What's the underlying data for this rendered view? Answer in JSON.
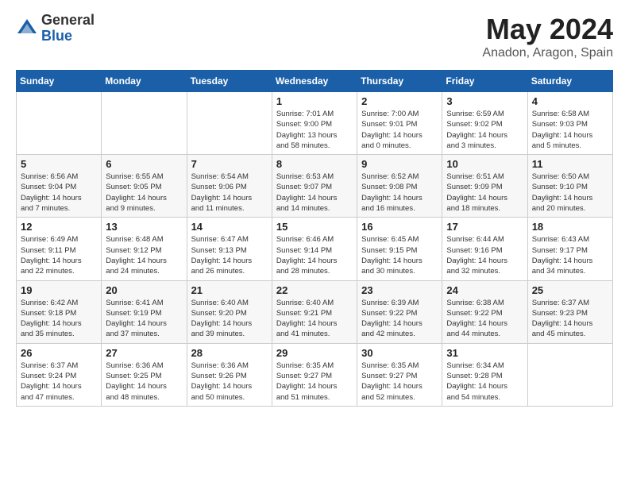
{
  "header": {
    "logo_general": "General",
    "logo_blue": "Blue",
    "month": "May 2024",
    "location": "Anadon, Aragon, Spain"
  },
  "weekdays": [
    "Sunday",
    "Monday",
    "Tuesday",
    "Wednesday",
    "Thursday",
    "Friday",
    "Saturday"
  ],
  "weeks": [
    [
      {
        "day": "",
        "info": ""
      },
      {
        "day": "",
        "info": ""
      },
      {
        "day": "",
        "info": ""
      },
      {
        "day": "1",
        "info": "Sunrise: 7:01 AM\nSunset: 9:00 PM\nDaylight: 13 hours\nand 58 minutes."
      },
      {
        "day": "2",
        "info": "Sunrise: 7:00 AM\nSunset: 9:01 PM\nDaylight: 14 hours\nand 0 minutes."
      },
      {
        "day": "3",
        "info": "Sunrise: 6:59 AM\nSunset: 9:02 PM\nDaylight: 14 hours\nand 3 minutes."
      },
      {
        "day": "4",
        "info": "Sunrise: 6:58 AM\nSunset: 9:03 PM\nDaylight: 14 hours\nand 5 minutes."
      }
    ],
    [
      {
        "day": "5",
        "info": "Sunrise: 6:56 AM\nSunset: 9:04 PM\nDaylight: 14 hours\nand 7 minutes."
      },
      {
        "day": "6",
        "info": "Sunrise: 6:55 AM\nSunset: 9:05 PM\nDaylight: 14 hours\nand 9 minutes."
      },
      {
        "day": "7",
        "info": "Sunrise: 6:54 AM\nSunset: 9:06 PM\nDaylight: 14 hours\nand 11 minutes."
      },
      {
        "day": "8",
        "info": "Sunrise: 6:53 AM\nSunset: 9:07 PM\nDaylight: 14 hours\nand 14 minutes."
      },
      {
        "day": "9",
        "info": "Sunrise: 6:52 AM\nSunset: 9:08 PM\nDaylight: 14 hours\nand 16 minutes."
      },
      {
        "day": "10",
        "info": "Sunrise: 6:51 AM\nSunset: 9:09 PM\nDaylight: 14 hours\nand 18 minutes."
      },
      {
        "day": "11",
        "info": "Sunrise: 6:50 AM\nSunset: 9:10 PM\nDaylight: 14 hours\nand 20 minutes."
      }
    ],
    [
      {
        "day": "12",
        "info": "Sunrise: 6:49 AM\nSunset: 9:11 PM\nDaylight: 14 hours\nand 22 minutes."
      },
      {
        "day": "13",
        "info": "Sunrise: 6:48 AM\nSunset: 9:12 PM\nDaylight: 14 hours\nand 24 minutes."
      },
      {
        "day": "14",
        "info": "Sunrise: 6:47 AM\nSunset: 9:13 PM\nDaylight: 14 hours\nand 26 minutes."
      },
      {
        "day": "15",
        "info": "Sunrise: 6:46 AM\nSunset: 9:14 PM\nDaylight: 14 hours\nand 28 minutes."
      },
      {
        "day": "16",
        "info": "Sunrise: 6:45 AM\nSunset: 9:15 PM\nDaylight: 14 hours\nand 30 minutes."
      },
      {
        "day": "17",
        "info": "Sunrise: 6:44 AM\nSunset: 9:16 PM\nDaylight: 14 hours\nand 32 minutes."
      },
      {
        "day": "18",
        "info": "Sunrise: 6:43 AM\nSunset: 9:17 PM\nDaylight: 14 hours\nand 34 minutes."
      }
    ],
    [
      {
        "day": "19",
        "info": "Sunrise: 6:42 AM\nSunset: 9:18 PM\nDaylight: 14 hours\nand 35 minutes."
      },
      {
        "day": "20",
        "info": "Sunrise: 6:41 AM\nSunset: 9:19 PM\nDaylight: 14 hours\nand 37 minutes."
      },
      {
        "day": "21",
        "info": "Sunrise: 6:40 AM\nSunset: 9:20 PM\nDaylight: 14 hours\nand 39 minutes."
      },
      {
        "day": "22",
        "info": "Sunrise: 6:40 AM\nSunset: 9:21 PM\nDaylight: 14 hours\nand 41 minutes."
      },
      {
        "day": "23",
        "info": "Sunrise: 6:39 AM\nSunset: 9:22 PM\nDaylight: 14 hours\nand 42 minutes."
      },
      {
        "day": "24",
        "info": "Sunrise: 6:38 AM\nSunset: 9:22 PM\nDaylight: 14 hours\nand 44 minutes."
      },
      {
        "day": "25",
        "info": "Sunrise: 6:37 AM\nSunset: 9:23 PM\nDaylight: 14 hours\nand 45 minutes."
      }
    ],
    [
      {
        "day": "26",
        "info": "Sunrise: 6:37 AM\nSunset: 9:24 PM\nDaylight: 14 hours\nand 47 minutes."
      },
      {
        "day": "27",
        "info": "Sunrise: 6:36 AM\nSunset: 9:25 PM\nDaylight: 14 hours\nand 48 minutes."
      },
      {
        "day": "28",
        "info": "Sunrise: 6:36 AM\nSunset: 9:26 PM\nDaylight: 14 hours\nand 50 minutes."
      },
      {
        "day": "29",
        "info": "Sunrise: 6:35 AM\nSunset: 9:27 PM\nDaylight: 14 hours\nand 51 minutes."
      },
      {
        "day": "30",
        "info": "Sunrise: 6:35 AM\nSunset: 9:27 PM\nDaylight: 14 hours\nand 52 minutes."
      },
      {
        "day": "31",
        "info": "Sunrise: 6:34 AM\nSunset: 9:28 PM\nDaylight: 14 hours\nand 54 minutes."
      },
      {
        "day": "",
        "info": ""
      }
    ]
  ]
}
